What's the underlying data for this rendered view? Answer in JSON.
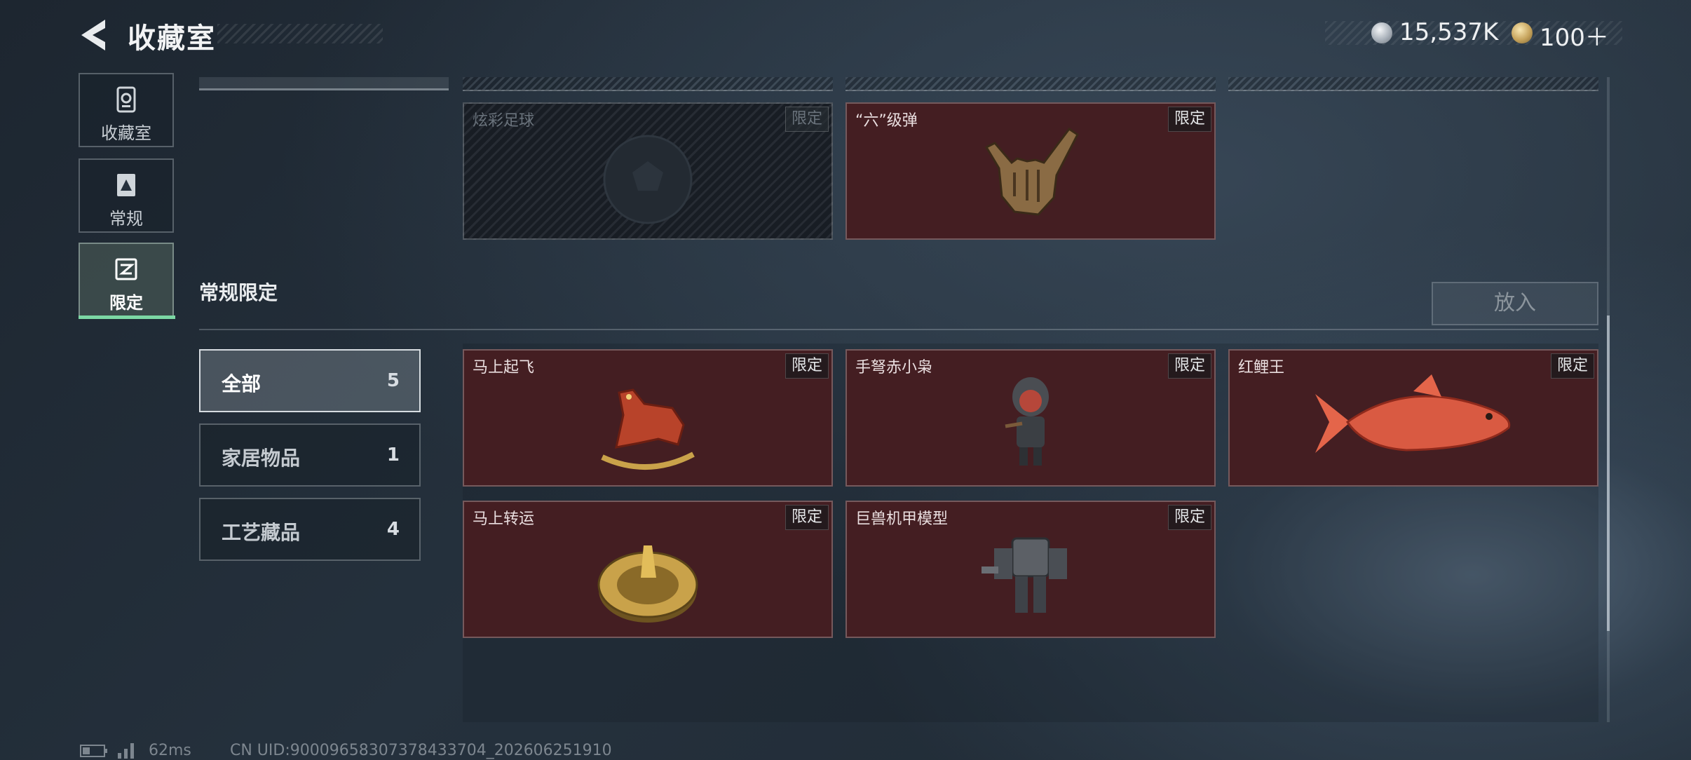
{
  "header": {
    "title": "收藏室",
    "currency": [
      {
        "icon": "silver-coin-icon",
        "value": "15,537K"
      },
      {
        "icon": "gold-coin-icon",
        "value": "100＋"
      }
    ]
  },
  "nav": {
    "items": [
      {
        "label": "收藏室",
        "icon": "collection-room-icon"
      },
      {
        "label": "常规",
        "icon": "regular-icon"
      },
      {
        "label": "限定",
        "icon": "limited-icon",
        "active": true
      }
    ],
    "accent_color": "#7cd8a4"
  },
  "top_cards": [
    {
      "name": "炫彩足球",
      "tag": "限定",
      "locked": true
    },
    {
      "name": "“六”级弹",
      "tag": "限定",
      "locked": false
    }
  ],
  "section": {
    "title": "常规限定",
    "put_button": "放入"
  },
  "categories": [
    {
      "label": "全部",
      "count": "5",
      "selected": true
    },
    {
      "label": "家居物品",
      "count": "1"
    },
    {
      "label": "工艺藏品",
      "count": "4"
    }
  ],
  "items": [
    {
      "name": "马上起飞",
      "tag": "限定",
      "art": "rocking-horse-icon"
    },
    {
      "name": "手弩赤小枭",
      "tag": "限定",
      "art": "hooded-figure-icon"
    },
    {
      "name": "红鲤王",
      "tag": "限定",
      "art": "red-carp-icon"
    },
    {
      "name": "马上转运",
      "tag": "限定",
      "art": "gold-wheel-icon"
    },
    {
      "name": "巨兽机甲模型",
      "tag": "限定",
      "art": "mech-model-icon"
    }
  ],
  "footer": {
    "ping": "62ms",
    "uid": "CN UID:9000965830737843370​4_202606251910"
  },
  "colors": {
    "card_bg": "#441e22",
    "background": "#25313d"
  }
}
